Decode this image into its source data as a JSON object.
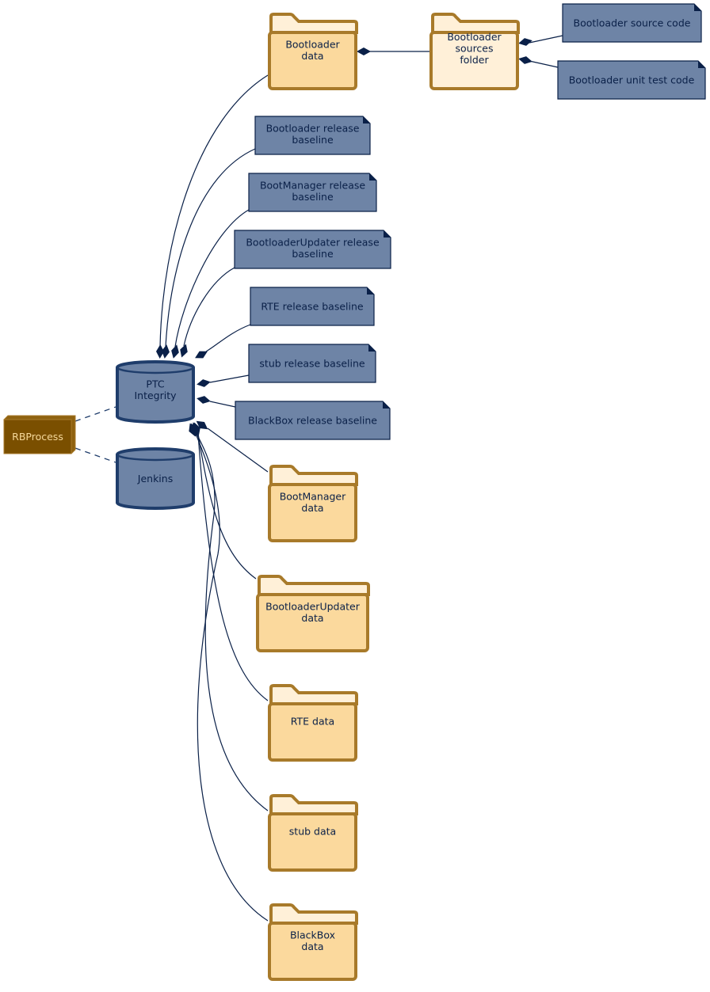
{
  "colors": {
    "folder_stroke": "#a87a2a",
    "folder_fill": "#fbd99d",
    "folder_tab": "#fff0d8",
    "note_fill": "#6e84a6",
    "note_stroke": "#0a2048",
    "db_fill": "#6e84a6",
    "db_stroke": "#1f3d6b",
    "process_fill": "#7a4f00",
    "process_text": "#f5d89a",
    "edge": "#0a2048"
  },
  "nodes": {
    "rbprocess": {
      "type": "process",
      "label": [
        "RBProcess"
      ]
    },
    "ptc": {
      "type": "database",
      "label": [
        "PTC",
        "Integrity"
      ]
    },
    "jenkins": {
      "type": "database",
      "label": [
        "Jenkins"
      ]
    },
    "bl_data": {
      "type": "folder",
      "label": [
        "Bootloader",
        "data"
      ]
    },
    "bl_src": {
      "type": "folder-light",
      "label": [
        "Bootloader",
        "sources",
        "folder"
      ]
    },
    "bl_src_code": {
      "type": "note",
      "label": [
        "Bootloader source code"
      ]
    },
    "bl_unit": {
      "type": "note",
      "label": [
        "Bootloader unit test code"
      ]
    },
    "bl_rel": {
      "type": "note",
      "label": [
        "Bootloader release",
        "baseline"
      ]
    },
    "bm_rel": {
      "type": "note",
      "label": [
        "BootManager release",
        "baseline"
      ]
    },
    "blu_rel": {
      "type": "note",
      "label": [
        "BootloaderUpdater release",
        "baseline"
      ]
    },
    "rte_rel": {
      "type": "note",
      "label": [
        "RTE release baseline"
      ]
    },
    "stub_rel": {
      "type": "note",
      "label": [
        "stub release baseline"
      ]
    },
    "bb_rel": {
      "type": "note",
      "label": [
        "BlackBox release baseline"
      ]
    },
    "bm_data": {
      "type": "folder",
      "label": [
        "BootManager",
        "data"
      ]
    },
    "blu_data": {
      "type": "folder",
      "label": [
        "BootloaderUpdater",
        "data"
      ]
    },
    "rte_data": {
      "type": "folder",
      "label": [
        "RTE data"
      ]
    },
    "stub_data": {
      "type": "folder",
      "label": [
        "stub data"
      ]
    },
    "bb_data": {
      "type": "folder",
      "label": [
        "BlackBox",
        "data"
      ]
    }
  }
}
